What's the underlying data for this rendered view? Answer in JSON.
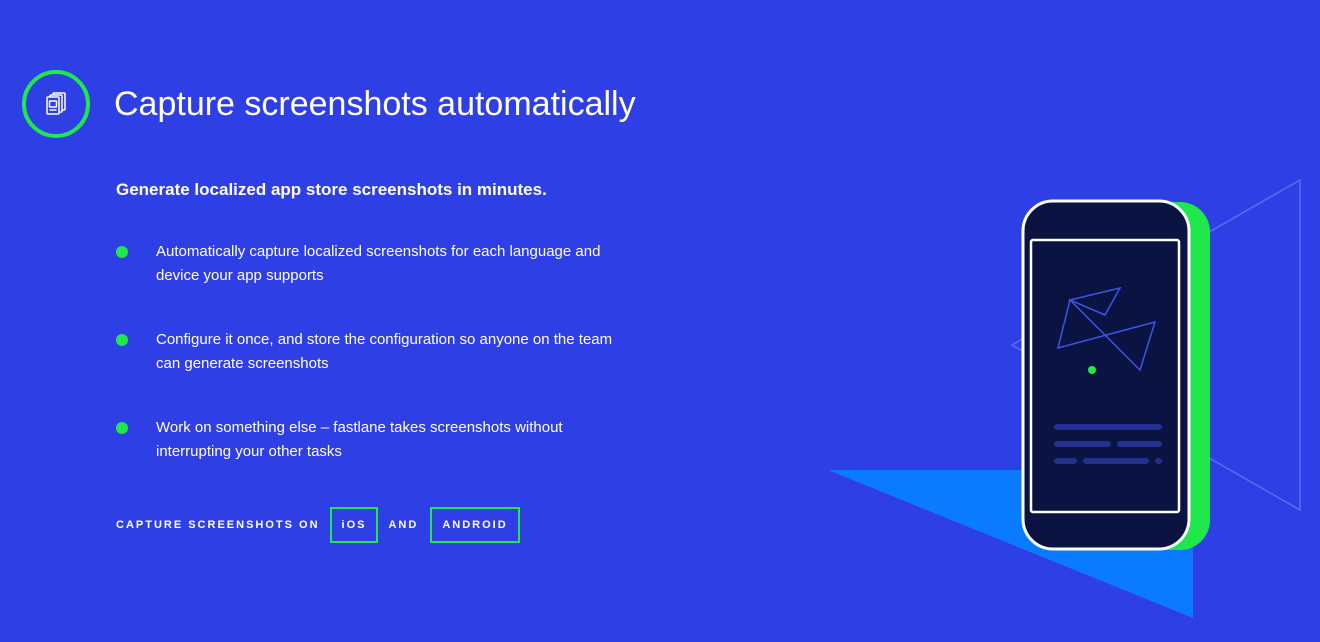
{
  "section": {
    "icon": "screenshots-stack-icon",
    "title": "Capture screenshots automatically",
    "subtitle": "Generate localized app store screenshots in minutes."
  },
  "features": [
    {
      "text": "Automatically capture localized screenshots for each language and device your app supports"
    },
    {
      "text": "Configure it once, and store the configuration so anyone on the team can generate screenshots"
    },
    {
      "text": "Work on something else – fastlane takes screenshots without interrupting your other tasks"
    }
  ],
  "platforms": {
    "lead": "CAPTURE SCREENSHOTS ON",
    "ios": "iOS",
    "joiner": "AND",
    "android": "ANDROID"
  },
  "colors": {
    "background": "#2f3fe6",
    "accent": "#20e84a",
    "phone": "#0b1342",
    "beam": "#0a7bff"
  }
}
